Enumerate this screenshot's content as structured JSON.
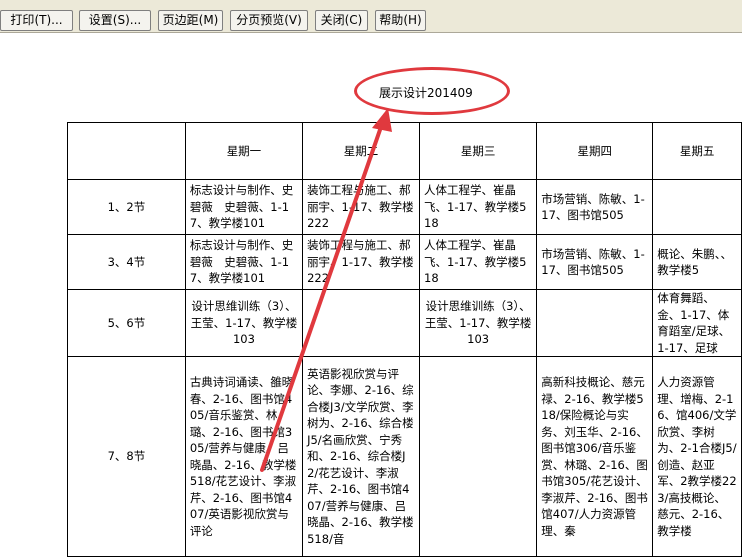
{
  "toolbar": {
    "print": {
      "label": "打印",
      "key": "(T)..."
    },
    "setup": {
      "label": "设置",
      "key": "(S)..."
    },
    "margins": {
      "label": "页边距",
      "key": "(M)"
    },
    "page_break": {
      "label": "分页预览",
      "key": "(V)"
    },
    "close": {
      "label": "关闭",
      "key": "(C)"
    },
    "help": {
      "label": "帮助",
      "key": "(H)"
    }
  },
  "page": {
    "title": "展示设计201409"
  },
  "schedule": {
    "days": [
      "星期一",
      "星期二",
      "星期三",
      "星期四",
      "星期五"
    ],
    "periods": [
      "1、2节",
      "3、4节",
      "5、6节",
      "7、8节"
    ],
    "cells": [
      [
        "标志设计与制作、史碧薇　史碧薇、1-17、教学楼101",
        "装饰工程与施工、郝丽宇、1-17、教学楼222",
        "人体工程学、崔晶飞、1-17、教学楼518",
        "市场营销、陈敏、1-17、图书馆505",
        ""
      ],
      [
        "标志设计与制作、史碧薇　史碧薇、1-17、教学楼101",
        "装饰工程与施工、郝丽宇、1-17、教学楼222",
        "人体工程学、崔晶飞、1-17、教学楼518",
        "市场营销、陈敏、1-17、图书馆505",
        "概论、朱鹏、、教学楼5"
      ],
      [
        "设计思维训练（3）、王莹、1-17、教学楼103",
        "",
        "设计思维训练（3）、王莹、1-17、教学楼103",
        "",
        "体育舞蹈、金、1-17、体育蹈室/足球、1-17、足球"
      ],
      [
        "古典诗词诵读、雒晓春、2-16、图书馆405/音乐鉴赏、林璐、2-16、图书馆305/营养与健康、吕晓晶、2-16、教学楼518/花艺设计、李淑芹、2-16、图书馆407/英语影视欣赏与评论",
        "英语影视欣赏与评论、李娜、2-16、综合楼J3/文学欣赏、李树为、2-16、综合楼J5/名画欣赏、宁秀和、2-16、综合楼J2/花艺设计、李淑芹、2-16、图书馆407/营养与健康、吕晓晶、2-16、教学楼518/音",
        "",
        "高新科技概论、慈元禄、2-16、教学楼518/保险概论与实务、刘玉华、2-16、图书馆306/音乐鉴赏、林璐、2-16、图书馆305/花艺设计、李淑芹、2-16、图书馆407/人力资源管理、秦",
        "人力资源管理、增梅、2-16、馆406/文学欣赏、李树为、2-1合楼J5/创造、赵亚军、2教学楼223/高技概论、慈元、2-16、教学楼"
      ]
    ]
  },
  "colors": {
    "annotation": "#e0393e",
    "toolbar_bg": "#ece9d8"
  }
}
